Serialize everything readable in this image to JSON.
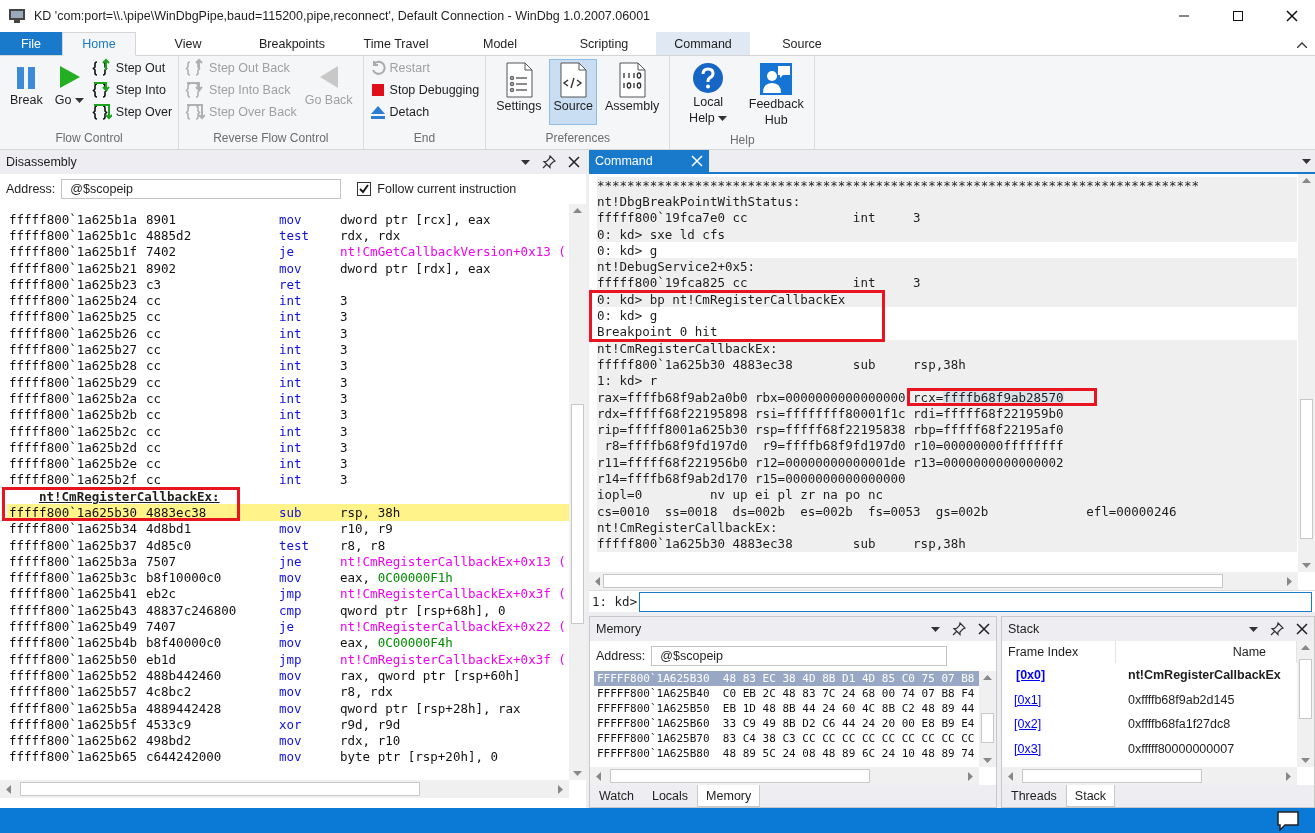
{
  "window": {
    "title": "KD 'com:port=\\\\.\\pipe\\WinDbgPipe,baud=115200,pipe,reconnect', Default Connection  - WinDbg 1.0.2007.06001"
  },
  "ribbon": {
    "tabs": [
      {
        "label": "File",
        "kind": "file",
        "selected": false
      },
      {
        "label": "Home",
        "kind": "plain",
        "selected": true
      },
      {
        "label": "View",
        "kind": "plain",
        "selected": false
      },
      {
        "label": "Breakpoints",
        "kind": "plain",
        "selected": false
      },
      {
        "label": "Time Travel",
        "kind": "plain",
        "selected": false
      },
      {
        "label": "Model",
        "kind": "plain",
        "selected": false
      },
      {
        "label": "Scripting",
        "kind": "plain",
        "selected": false
      },
      {
        "label": "Command",
        "kind": "context",
        "selected": false
      },
      {
        "label": "Source",
        "kind": "plain",
        "selected": false
      }
    ],
    "groups": [
      {
        "label": "Flow Control",
        "items": [
          {
            "kind": "large",
            "label": "Break",
            "disabled": false,
            "selected": false,
            "menu": false
          },
          {
            "kind": "large",
            "label": "Go",
            "disabled": false,
            "selected": false,
            "menu": true
          },
          {
            "kind": "small",
            "label": "Step Out",
            "disabled": false
          },
          {
            "kind": "small",
            "label": "Step Into",
            "disabled": false
          },
          {
            "kind": "small",
            "label": "Step Over",
            "disabled": false
          }
        ]
      },
      {
        "label": "Reverse Flow Control",
        "items": [
          {
            "kind": "small",
            "label": "Step Out Back",
            "disabled": true
          },
          {
            "kind": "small",
            "label": "Step Into Back",
            "disabled": true
          },
          {
            "kind": "small",
            "label": "Step Over Back",
            "disabled": true
          },
          {
            "kind": "large",
            "label": "Go Back",
            "disabled": true,
            "selected": false,
            "menu": false
          }
        ]
      },
      {
        "label": "End",
        "items": [
          {
            "kind": "small",
            "label": "Restart",
            "disabled": true
          },
          {
            "kind": "small",
            "label": "Stop Debugging",
            "disabled": false
          },
          {
            "kind": "small",
            "label": "Detach",
            "disabled": false
          }
        ]
      },
      {
        "label": "Preferences",
        "items": [
          {
            "kind": "large",
            "label": "Settings",
            "disabled": false,
            "selected": false,
            "menu": false
          },
          {
            "kind": "large",
            "label": "Source",
            "disabled": false,
            "selected": true,
            "menu": false
          },
          {
            "kind": "large",
            "label": "Assembly",
            "disabled": false,
            "selected": false,
            "menu": false
          }
        ]
      },
      {
        "label": "Help",
        "items": [
          {
            "kind": "large",
            "label": "Local Help",
            "disabled": false,
            "selected": false,
            "menu": true
          },
          {
            "kind": "large",
            "label": "Feedback Hub",
            "disabled": false,
            "selected": false,
            "menu": false
          }
        ]
      }
    ]
  },
  "disassembly": {
    "title": "Disassembly",
    "address_label": "Address:",
    "address": "@$scopeip",
    "follow": {
      "label": "Follow current instruction",
      "checked": true
    },
    "rows": [
      {
        "kind": "code",
        "address": "fffff800`1a625b1a",
        "bytes": "8901",
        "mnemonic": "mov",
        "operands": "dword ptr [rcx], eax",
        "current": false
      },
      {
        "kind": "code",
        "address": "fffff800`1a625b1c",
        "bytes": "4885d2",
        "mnemonic": "test",
        "operands": "rdx, rdx",
        "current": false
      },
      {
        "kind": "code",
        "address": "fffff800`1a625b1f",
        "bytes": "7402",
        "mnemonic": "je",
        "target": "nt!CmGetCallbackVersion+0x13 (",
        "current": false
      },
      {
        "kind": "code",
        "address": "fffff800`1a625b21",
        "bytes": "8902",
        "mnemonic": "mov",
        "operands": "dword ptr [rdx], eax",
        "current": false
      },
      {
        "kind": "code",
        "address": "fffff800`1a625b23",
        "bytes": "c3",
        "mnemonic": "ret",
        "current": false
      },
      {
        "kind": "code",
        "address": "fffff800`1a625b24",
        "bytes": "cc",
        "mnemonic": "int",
        "operands": "3",
        "current": false
      },
      {
        "kind": "code",
        "address": "fffff800`1a625b25",
        "bytes": "cc",
        "mnemonic": "int",
        "operands": "3",
        "current": false
      },
      {
        "kind": "code",
        "address": "fffff800`1a625b26",
        "bytes": "cc",
        "mnemonic": "int",
        "operands": "3",
        "current": false
      },
      {
        "kind": "code",
        "address": "fffff800`1a625b27",
        "bytes": "cc",
        "mnemonic": "int",
        "operands": "3",
        "current": false
      },
      {
        "kind": "code",
        "address": "fffff800`1a625b28",
        "bytes": "cc",
        "mnemonic": "int",
        "operands": "3",
        "current": false
      },
      {
        "kind": "code",
        "address": "fffff800`1a625b29",
        "bytes": "cc",
        "mnemonic": "int",
        "operands": "3",
        "current": false
      },
      {
        "kind": "code",
        "address": "fffff800`1a625b2a",
        "bytes": "cc",
        "mnemonic": "int",
        "operands": "3",
        "current": false
      },
      {
        "kind": "code",
        "address": "fffff800`1a625b2b",
        "bytes": "cc",
        "mnemonic": "int",
        "operands": "3",
        "current": false
      },
      {
        "kind": "code",
        "address": "fffff800`1a625b2c",
        "bytes": "cc",
        "mnemonic": "int",
        "operands": "3",
        "current": false
      },
      {
        "kind": "code",
        "address": "fffff800`1a625b2d",
        "bytes": "cc",
        "mnemonic": "int",
        "operands": "3",
        "current": false
      },
      {
        "kind": "code",
        "address": "fffff800`1a625b2e",
        "bytes": "cc",
        "mnemonic": "int",
        "operands": "3",
        "current": false
      },
      {
        "kind": "code",
        "address": "fffff800`1a625b2f",
        "bytes": "cc",
        "mnemonic": "int",
        "operands": "3",
        "current": false
      },
      {
        "kind": "label",
        "text": "nt!CmRegisterCallbackEx:"
      },
      {
        "kind": "code",
        "address": "fffff800`1a625b30",
        "bytes": "4883ec38",
        "mnemonic": "sub",
        "operands": "rsp, 38h",
        "current": true
      },
      {
        "kind": "code",
        "address": "fffff800`1a625b34",
        "bytes": "4d8bd1",
        "mnemonic": "mov",
        "operands": "r10, r9",
        "current": false
      },
      {
        "kind": "code",
        "address": "fffff800`1a625b37",
        "bytes": "4d85c0",
        "mnemonic": "test",
        "operands": "r8, r8",
        "current": false
      },
      {
        "kind": "code",
        "address": "fffff800`1a625b3a",
        "bytes": "7507",
        "mnemonic": "jne",
        "target": "nt!CmRegisterCallbackEx+0x13 (",
        "current": false
      },
      {
        "kind": "code",
        "address": "fffff800`1a625b3c",
        "bytes": "b8f10000c0",
        "mnemonic": "mov",
        "operands": "eax, ",
        "constant": "0C00000F1h",
        "current": false
      },
      {
        "kind": "code",
        "address": "fffff800`1a625b41",
        "bytes": "eb2c",
        "mnemonic": "jmp",
        "target": "nt!CmRegisterCallbackEx+0x3f (",
        "current": false
      },
      {
        "kind": "code",
        "address": "fffff800`1a625b43",
        "bytes": "48837c246800",
        "mnemonic": "cmp",
        "operands": "qword ptr [rsp+68h], 0",
        "current": false
      },
      {
        "kind": "code",
        "address": "fffff800`1a625b49",
        "bytes": "7407",
        "mnemonic": "je",
        "target": "nt!CmRegisterCallbackEx+0x22 (",
        "current": false
      },
      {
        "kind": "code",
        "address": "fffff800`1a625b4b",
        "bytes": "b8f40000c0",
        "mnemonic": "mov",
        "operands": "eax, ",
        "constant": "0C00000F4h",
        "current": false
      },
      {
        "kind": "code",
        "address": "fffff800`1a625b50",
        "bytes": "eb1d",
        "mnemonic": "jmp",
        "target": "nt!CmRegisterCallbackEx+0x3f (",
        "current": false
      },
      {
        "kind": "code",
        "address": "fffff800`1a625b52",
        "bytes": "488b442460",
        "mnemonic": "mov",
        "operands": "rax, qword ptr [rsp+60h]",
        "current": false
      },
      {
        "kind": "code",
        "address": "fffff800`1a625b57",
        "bytes": "4c8bc2",
        "mnemonic": "mov",
        "operands": "r8, rdx",
        "current": false
      },
      {
        "kind": "code",
        "address": "fffff800`1a625b5a",
        "bytes": "4889442428",
        "mnemonic": "mov",
        "operands": "qword ptr [rsp+28h], rax",
        "current": false
      },
      {
        "kind": "code",
        "address": "fffff800`1a625b5f",
        "bytes": "4533c9",
        "mnemonic": "xor",
        "operands": "r9d, r9d",
        "current": false
      },
      {
        "kind": "code",
        "address": "fffff800`1a625b62",
        "bytes": "498bd2",
        "mnemonic": "mov",
        "operands": "rdx, r10",
        "current": false
      },
      {
        "kind": "code",
        "address": "fffff800`1a625b65",
        "bytes": "c644242000",
        "mnemonic": "mov",
        "operands": "byte ptr [rsp+20h], 0",
        "current": false
      }
    ]
  },
  "command": {
    "title": "Command",
    "lines": [
      {
        "text": "********************************************************************************",
        "shaded": true
      },
      {
        "text": "nt!DbgBreakPointWithStatus:",
        "shaded": true
      },
      {
        "text": "fffff800`19fca7e0 cc              int     3",
        "shaded": true
      },
      {
        "text": "0: kd> sxe ld cfs",
        "shaded": true
      },
      {
        "text": "0: kd> g",
        "shaded": false
      },
      {
        "text": "nt!DebugService2+0x5:",
        "shaded": true
      },
      {
        "text": "fffff800`19fca825 cc              int     3",
        "shaded": true
      },
      {
        "text": "0: kd> bp nt!CmRegisterCallbackEx",
        "shaded": true
      },
      {
        "text": "0: kd> g",
        "shaded": false
      },
      {
        "text": "Breakpoint 0 hit",
        "shaded": false
      },
      {
        "text": "nt!CmRegisterCallbackEx:",
        "shaded": true
      },
      {
        "text": "fffff800`1a625b30 4883ec38        sub     rsp,38h",
        "shaded": true
      },
      {
        "text": "1: kd> r",
        "shaded": true
      },
      {
        "text": "rax=ffffb68f9ab2a0b0 rbx=0000000000000000 rcx=",
        "selection": "ffffb68f9ab28570",
        "shaded": true
      },
      {
        "text": "rdx=fffff68f22195898 rsi=ffffffff80001f1c rdi=fffff68f221959b0",
        "shaded": true
      },
      {
        "text": "rip=fffff8001a625b30 rsp=fffff68f22195838 rbp=fffff68f22195af0",
        "shaded": true
      },
      {
        "text": " r8=ffffb68f9fd197d0  r9=ffffb68f9fd197d0 r10=00000000ffffffff",
        "shaded": true
      },
      {
        "text": "r11=fffff68f221956b0 r12=00000000000001de r13=0000000000000002",
        "shaded": true
      },
      {
        "text": "r14=ffffb68f9ab2d170 r15=0000000000000000",
        "shaded": true
      },
      {
        "text": "iopl=0         nv up ei pl zr na po nc",
        "shaded": true
      },
      {
        "text": "cs=0010  ss=0018  ds=002b  es=002b  fs=0053  gs=002b             efl=00000246",
        "shaded": true
      },
      {
        "text": "nt!CmRegisterCallbackEx:",
        "shaded": true
      },
      {
        "text": "fffff800`1a625b30 4883ec38        sub     rsp,38h",
        "shaded": true
      }
    ],
    "prompt": "1: kd>"
  },
  "memory": {
    "title": "Memory",
    "address_label": "Address:",
    "address": "@$scopeip",
    "rows": [
      {
        "address": "FFFFF800`1A625B30",
        "bytes": "48 83 EC 38 4D 8B D1 4D 85 C0 75 07 B8",
        "selected": true
      },
      {
        "address": "FFFFF800`1A625B40",
        "bytes": "C0 EB 2C 48 83 7C 24 68 00 74 07 B8 F4",
        "selected": false
      },
      {
        "address": "FFFFF800`1A625B50",
        "bytes": "EB 1D 48 8B 44 24 60 4C 8B C2 48 89 44",
        "selected": false
      },
      {
        "address": "FFFFF800`1A625B60",
        "bytes": "33 C9 49 8B D2 C6 44 24 20 00 E8 B9 E4",
        "selected": false
      },
      {
        "address": "FFFFF800`1A625B70",
        "bytes": "83 C4 38 C3 CC CC CC CC CC CC CC CC CC",
        "selected": false
      },
      {
        "address": "FFFFF800`1A625B80",
        "bytes": "48 89 5C 24 08 48 89 6C 24 10 48 89 74",
        "selected": false
      }
    ],
    "tabs": [
      {
        "label": "Watch",
        "selected": false
      },
      {
        "label": "Locals",
        "selected": false
      },
      {
        "label": "Memory",
        "selected": true
      }
    ]
  },
  "stack": {
    "title": "Stack",
    "columns": [
      "Frame Index",
      "Name"
    ],
    "frames": [
      {
        "index": "[0x0]",
        "name": "nt!CmRegisterCallbackEx",
        "selected": true
      },
      {
        "index": "[0x1]",
        "name": "0xffffb68f9ab2d145",
        "selected": false
      },
      {
        "index": "[0x2]",
        "name": "0xffffb68fa1f27dc8",
        "selected": false
      },
      {
        "index": "[0x3]",
        "name": "0xfffff80000000007",
        "selected": false
      }
    ],
    "tabs": [
      {
        "label": "Threads",
        "selected": false
      },
      {
        "label": "Stack",
        "selected": true
      }
    ]
  }
}
